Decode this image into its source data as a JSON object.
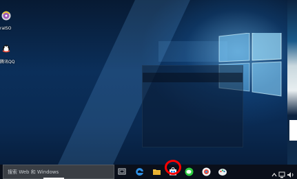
{
  "desktop": {
    "icons": [
      {
        "name": "ultraiso",
        "label": "raISO"
      },
      {
        "name": "qq",
        "label": "腾讯QQ"
      }
    ]
  },
  "taskbar": {
    "search_placeholder": "搜索 Web 和 Windows",
    "apps": [
      "task-view",
      "edge",
      "file-explorer",
      "store",
      "wechat",
      "qq-browser",
      "paint"
    ],
    "highlighted_app": "store",
    "highlight_color": "#ff0000"
  },
  "colors": {
    "wallpaper": "#0b2f5a",
    "taskbar": "#0a0f1a",
    "search_box": "#3a3e44"
  }
}
